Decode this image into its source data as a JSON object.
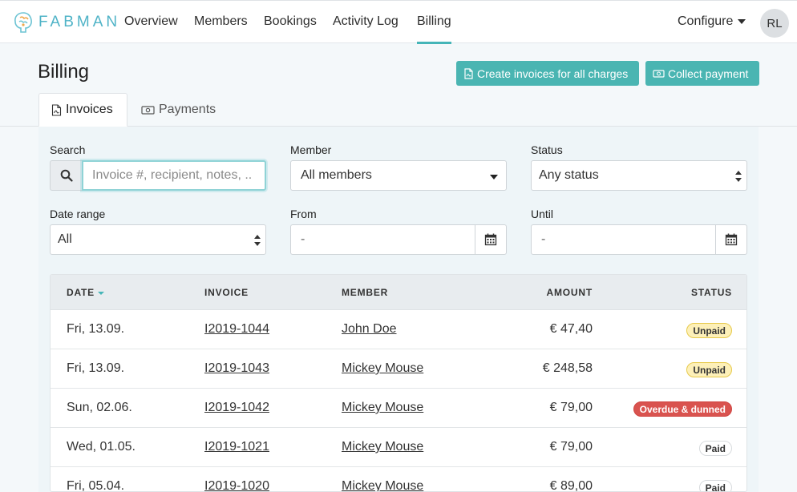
{
  "app": {
    "brand": "FABMAN"
  },
  "nav": {
    "items": [
      {
        "label": "Overview"
      },
      {
        "label": "Members"
      },
      {
        "label": "Bookings"
      },
      {
        "label": "Activity Log"
      },
      {
        "label": "Billing"
      }
    ],
    "active": "Billing",
    "configure_label": "Configure",
    "avatar_initials": "RL"
  },
  "header": {
    "title": "Billing",
    "create_invoices_label": "Create invoices for all charges",
    "collect_payment_label": "Collect payment"
  },
  "tabs": [
    {
      "label": "Invoices",
      "active": true
    },
    {
      "label": "Payments",
      "active": false
    }
  ],
  "filters": {
    "search": {
      "label": "Search",
      "placeholder": "Invoice #, recipient, notes, ..",
      "value": ""
    },
    "member": {
      "label": "Member",
      "value": "All members"
    },
    "status": {
      "label": "Status",
      "value": "Any status"
    },
    "date_range": {
      "label": "Date range",
      "value": "All"
    },
    "from": {
      "label": "From",
      "value": "-"
    },
    "until": {
      "label": "Until",
      "value": "-"
    }
  },
  "table": {
    "columns": [
      "DATE",
      "INVOICE",
      "MEMBER",
      "AMOUNT",
      "STATUS"
    ],
    "rows": [
      {
        "date": "Fri, 13.09.",
        "invoice": "I2019-1044",
        "member": "John Doe",
        "amount": "€ 47,40",
        "status": "Unpaid"
      },
      {
        "date": "Fri, 13.09.",
        "invoice": "I2019-1043",
        "member": "Mickey Mouse",
        "amount": "€ 248,58",
        "status": "Unpaid"
      },
      {
        "date": "Sun, 02.06.",
        "invoice": "I2019-1042",
        "member": "Mickey Mouse",
        "amount": "€ 79,00",
        "status": "Overdue & dunned"
      },
      {
        "date": "Wed, 01.05.",
        "invoice": "I2019-1021",
        "member": "Mickey Mouse",
        "amount": "€ 79,00",
        "status": "Paid"
      },
      {
        "date": "Fri, 05.04.",
        "invoice": "I2019-1020",
        "member": "Mickey Mouse",
        "amount": "€ 89,00",
        "status": "Paid"
      }
    ]
  },
  "colors": {
    "accent": "#4ab5b2",
    "unpaid": "#fdf0b8",
    "overdue": "#d9534f",
    "paid": "#ffffff"
  },
  "icons": [
    "brain-logo-icon",
    "caret-down-icon",
    "pdf-file-icon",
    "money-icon",
    "search-icon",
    "calendar-icon",
    "sort-caret-icon"
  ]
}
